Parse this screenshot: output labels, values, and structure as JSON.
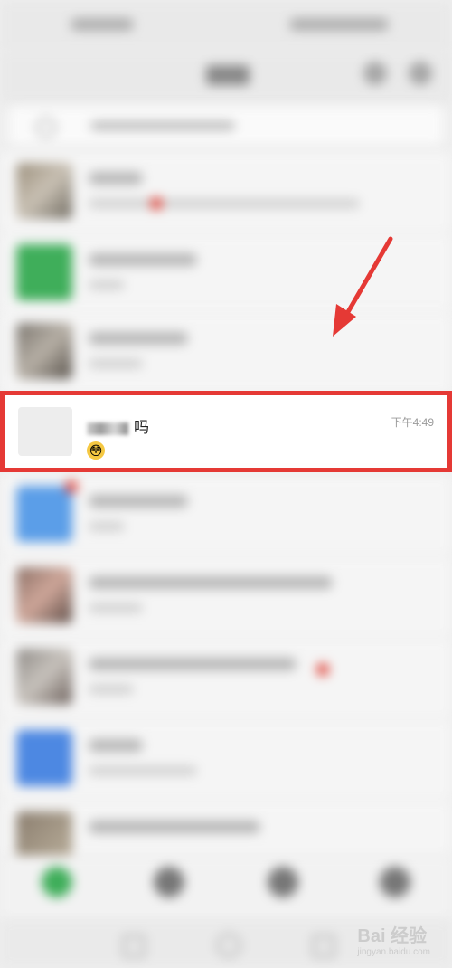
{
  "chat_list": {
    "selected_chat": {
      "name": "吗",
      "time": "下午4:49",
      "preview_emoji": "😳"
    }
  },
  "annotation": {
    "highlight_color": "#e53935",
    "arrow_color": "#e53935"
  },
  "watermark": {
    "brand": "Bai 经验",
    "url": "jingyan.baidu.com"
  },
  "icons": [
    "search-icon",
    "add-icon",
    "chats-tab-icon",
    "contacts-tab-icon",
    "discover-tab-icon",
    "me-tab-icon",
    "arrow-annotation-icon"
  ]
}
